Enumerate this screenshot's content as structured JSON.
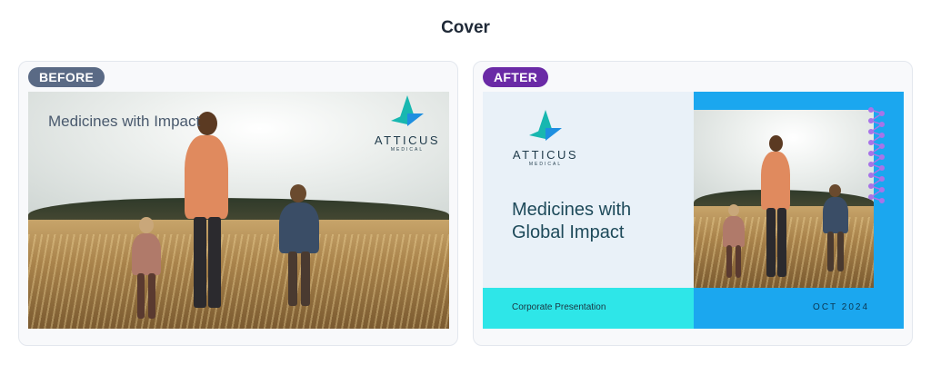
{
  "page": {
    "title": "Cover"
  },
  "before": {
    "badge": "BEFORE",
    "slide_title": "Medicines with Impact",
    "logo": {
      "name": "ATTICUS",
      "sub": "MEDICAL"
    }
  },
  "after": {
    "badge": "AFTER",
    "slide_title": "Medicines with Global Impact",
    "logo": {
      "name": "ATTICUS",
      "sub": "MEDICAL"
    },
    "band_label": "Corporate Presentation",
    "date": "OCT 2024"
  },
  "colors": {
    "before_badge": "#5a6a85",
    "after_badge": "#6a2aa6",
    "after_panel_light": "#e9f1f8",
    "after_accent_blue": "#1ba7ef",
    "after_accent_cyan": "#2ee6e8",
    "dots_purple": "#a874e8",
    "logo_teal": "#18b7b0",
    "logo_blue": "#1e8fe0"
  }
}
